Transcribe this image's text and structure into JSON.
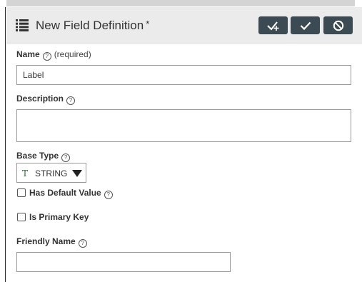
{
  "header": {
    "title": "New Field Definition",
    "dirty_marker": "*",
    "buttons": {
      "save_and_new_icon": "check-plus-icon",
      "save_icon": "check-icon",
      "cancel_icon": "cancel-icon"
    }
  },
  "form": {
    "name": {
      "label": "Name",
      "required_note": "(required)",
      "value": "Label"
    },
    "description": {
      "label": "Description",
      "value": ""
    },
    "base_type": {
      "label": "Base Type",
      "type_icon": "T",
      "value": "STRING"
    },
    "has_default_value": {
      "label": "Has Default Value",
      "checked": false
    },
    "is_primary_key": {
      "label": "Is Primary Key",
      "checked": false
    },
    "friendly_name": {
      "label": "Friendly Name",
      "value": ""
    }
  },
  "colors": {
    "header_bg": "#ebebeb",
    "button_bg": "#3c4a54",
    "input_border": "#999999"
  }
}
